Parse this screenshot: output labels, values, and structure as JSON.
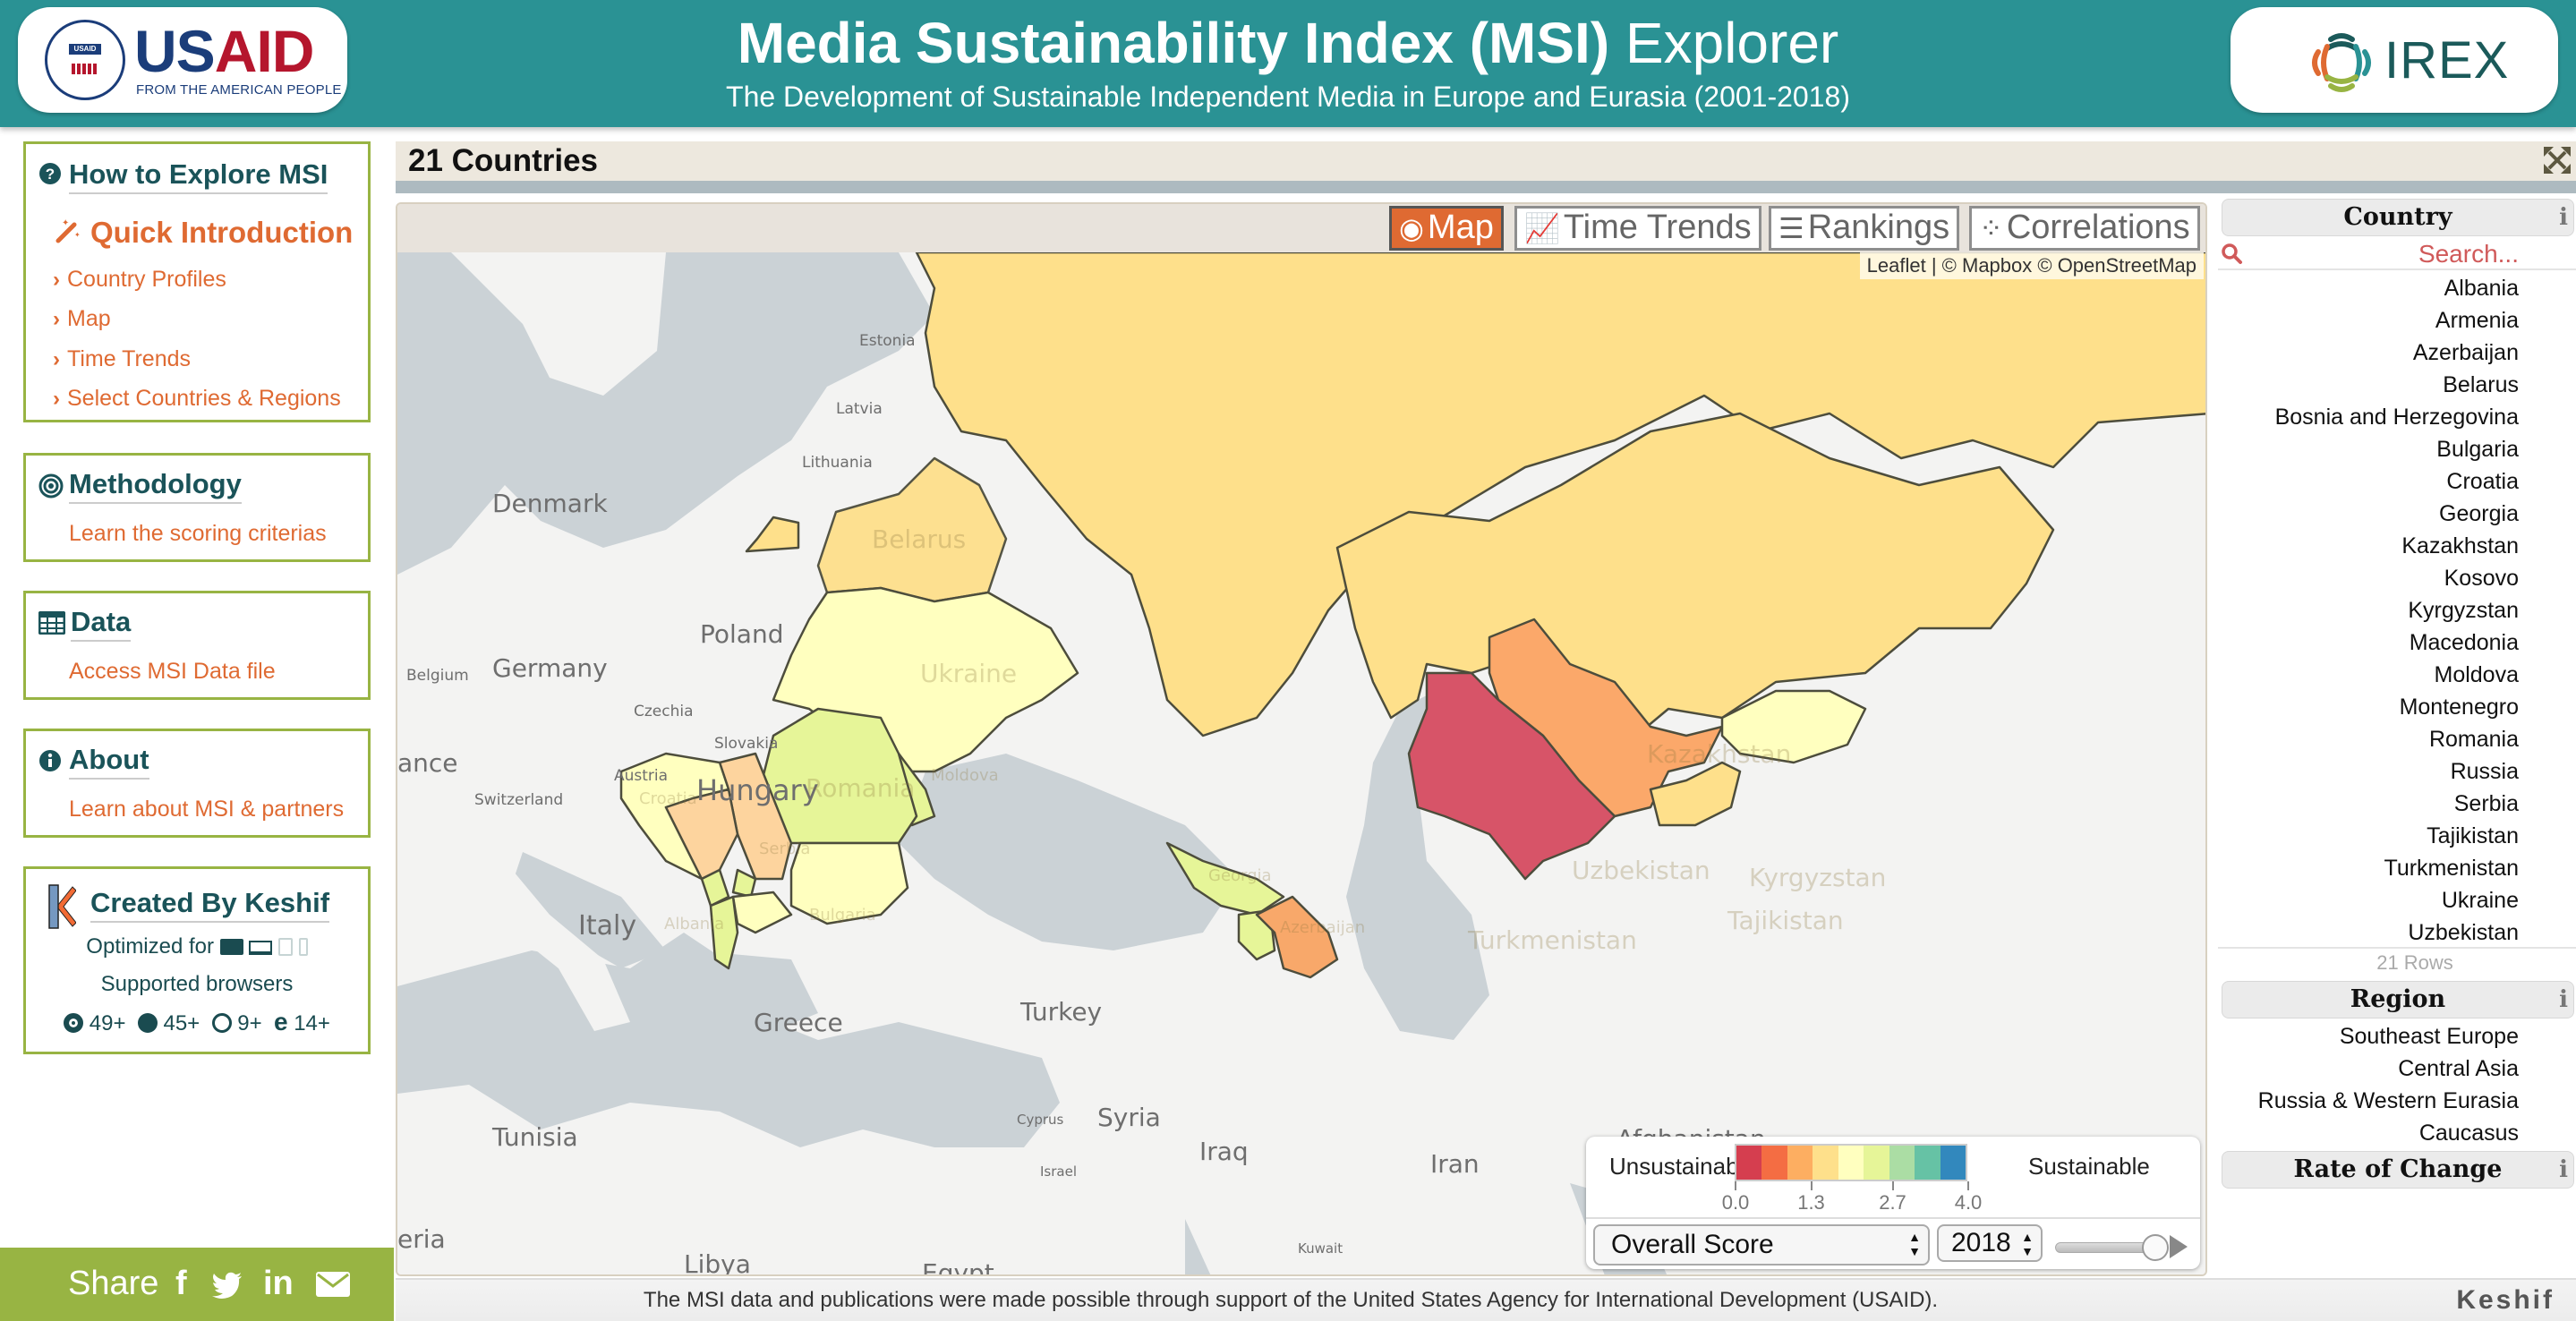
{
  "header": {
    "title_bold": "Media Sustainability Index (MSI)",
    "title_light": "Explorer",
    "subtitle": "The Development of Sustainable Independent Media in Europe and Eurasia (2001-2018)",
    "left_logo": {
      "seal_text": "USAID",
      "wordmark_a": "US",
      "wordmark_b": "AID",
      "tagline": "FROM THE AMERICAN PEOPLE"
    },
    "right_logo": {
      "wordmark": "IREX"
    }
  },
  "sidebar": {
    "explore": {
      "title": "How to Explore MSI",
      "quick_intro": "Quick Introduction",
      "links": [
        "Country Profiles",
        "Map",
        "Time Trends",
        "Select Countries & Regions"
      ]
    },
    "methodology": {
      "title": "Methodology",
      "link": "Learn the scoring criterias"
    },
    "data": {
      "title": "Data",
      "link": "Access MSI Data file"
    },
    "about": {
      "title": "About",
      "link": "Learn about MSI & partners"
    },
    "keshif": {
      "title": "Created By Keshif",
      "optimized_for": "Optimized for",
      "supported": "Supported browsers",
      "browsers": [
        {
          "icon": "chrome-icon",
          "version": "49+"
        },
        {
          "icon": "firefox-icon",
          "version": "45+"
        },
        {
          "icon": "safari-icon",
          "version": "9+"
        },
        {
          "icon": "edge-icon",
          "version": "14+"
        }
      ]
    },
    "share": {
      "label": "Share",
      "icons": [
        "facebook-icon",
        "twitter-icon",
        "linkedin-icon",
        "email-icon"
      ]
    }
  },
  "main": {
    "record_count": "21 Countries",
    "views": [
      {
        "label": "Map",
        "icon": "globe-icon",
        "active": true
      },
      {
        "label": "Time Trends",
        "icon": "line-chart-icon",
        "active": false
      },
      {
        "label": "Rankings",
        "icon": "list-icon",
        "active": false
      },
      {
        "label": "Correlations",
        "icon": "scatter-icon",
        "active": false
      }
    ],
    "attribution": "Leaflet | © Mapbox © OpenStreetMap",
    "map": {
      "basemap_labels": [
        "Estonia",
        "Latvia",
        "Lithuania",
        "Denmark",
        "Poland",
        "Germany",
        "Belgium",
        "Czechia",
        "Slovakia",
        "Austria",
        "Switzerland",
        "ance",
        "Hungary",
        "Italy",
        "Greece",
        "Turkey",
        "Cyprus",
        "Syria",
        "Israel",
        "Iraq",
        "Iran",
        "Kuwait",
        "Afghanistan",
        "Tunisia",
        "eria",
        "Libya",
        "Egypt"
      ],
      "country_labels": [
        "Belarus",
        "Ukraine",
        "Romania",
        "Moldova",
        "Croatia",
        "Serbia",
        "Bulgaria",
        "Albania",
        "Georgia",
        "Azerbaijan",
        "Kazakhstan",
        "Uzbekistan",
        "Turkmenistan",
        "Kyrgyzstan",
        "Tajikistan"
      ]
    },
    "legend": {
      "low_label": "Unsustainable",
      "high_label": "Sustainable",
      "colors": [
        "#d53e4f",
        "#f46d43",
        "#fdae61",
        "#fee08b",
        "#ffffbf",
        "#e6f598",
        "#abdda4",
        "#66c2a5",
        "#3288bd"
      ],
      "ticks": [
        "0.0",
        "1.3",
        "2.7",
        "4.0"
      ],
      "tick_values": [
        0,
        1.3,
        2.7,
        4.0
      ],
      "range": [
        0,
        4.0
      ],
      "metric": "Overall Score",
      "year": "2018",
      "year_slider_fraction": 1.0
    }
  },
  "right_panel": {
    "country_facet": {
      "title": "Country",
      "search_placeholder": "Search...",
      "items": [
        "Albania",
        "Armenia",
        "Azerbaijan",
        "Belarus",
        "Bosnia and Herzegovina",
        "Bulgaria",
        "Croatia",
        "Georgia",
        "Kazakhstan",
        "Kosovo",
        "Kyrgyzstan",
        "Macedonia",
        "Moldova",
        "Montenegro",
        "Romania",
        "Russia",
        "Serbia",
        "Tajikistan",
        "Turkmenistan",
        "Ukraine",
        "Uzbekistan"
      ],
      "rows_label": "21 Rows"
    },
    "region_facet": {
      "title": "Region",
      "items": [
        "Southeast Europe",
        "Central Asia",
        "Russia & Western Eurasia",
        "Caucasus"
      ]
    },
    "rate_facet": {
      "title": "Rate of Change"
    }
  },
  "footer": {
    "note": "The MSI data and publications were made possible through support of the United States Agency for International Development (USAID).",
    "brand": "Keshif"
  },
  "colors": {
    "header_teal": "#2a9294",
    "sidebar_border": "#98b443",
    "link_orange": "#df6a32",
    "heading_teal": "#1a5359",
    "search_red": "#d05a5a"
  }
}
